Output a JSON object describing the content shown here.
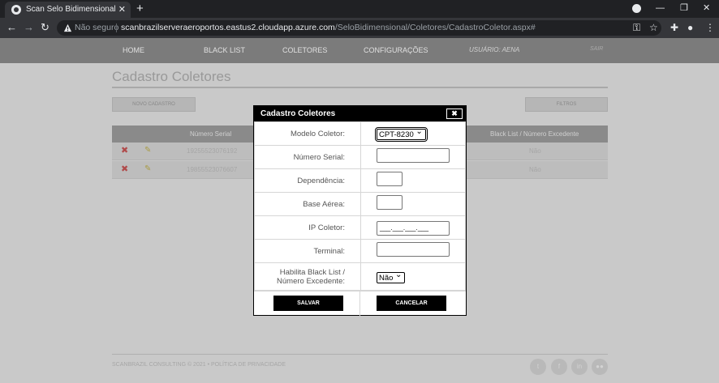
{
  "browser": {
    "tab_title": "Scan Selo Bidimensional",
    "tab_close": "✕",
    "new_tab": "+",
    "security_label": "Não seguro",
    "url_host": "scanbrazilserveraeroportos.eastus2.cloudapp.azure.com",
    "url_path": "/SeloBidimensional/Coletores/CadastroColetor.aspx#"
  },
  "site_nav": {
    "home": "HOME",
    "blacklist": "BLACK LIST",
    "coletores": "COLETORES",
    "config": "CONFIGURAÇÕES",
    "user": "USUÁRIO: AENA",
    "exit": "SAIR"
  },
  "page": {
    "title": "Cadastro Coletores",
    "new_button": "NOVO CADASTRO",
    "filter_button": "FILTROS",
    "grid_headers": {
      "serial": "Número Serial",
      "blacklist": "Black List / Número Excedente"
    },
    "rows": [
      {
        "serial": "19255523076192",
        "blacklist": "Não"
      },
      {
        "serial": "19855523076607",
        "blacklist": "Não"
      }
    ],
    "footer": "SCANBRAZIL CONSULTING © 2021 • POLÍTICA DE PRIVACIDADE",
    "social": [
      "t",
      "f",
      "in",
      "●●"
    ]
  },
  "modal": {
    "title": "Cadastro Coletores",
    "close": "✖",
    "fields": {
      "modelo_label": "Modelo Coletor:",
      "modelo_value": "CPT-8230",
      "serial_label": "Número Serial:",
      "serial_value": "",
      "dependencia_label": "Dependência:",
      "dependencia_value": "",
      "base_label": "Base Aérea:",
      "base_value": "",
      "ip_label": "IP Coletor:",
      "ip_value": "___.___.___.___",
      "terminal_label": "Terminal:",
      "terminal_value": "",
      "blacklist_label": "Habilita Black List / Número Excedente:",
      "blacklist_value": "Não"
    },
    "save": "SALVAR",
    "cancel": "CANCELAR"
  },
  "colors": {
    "modal_header": "#000000",
    "nav_bar": "#7b7b7b",
    "overlay_bg": "#c9c9c9"
  }
}
